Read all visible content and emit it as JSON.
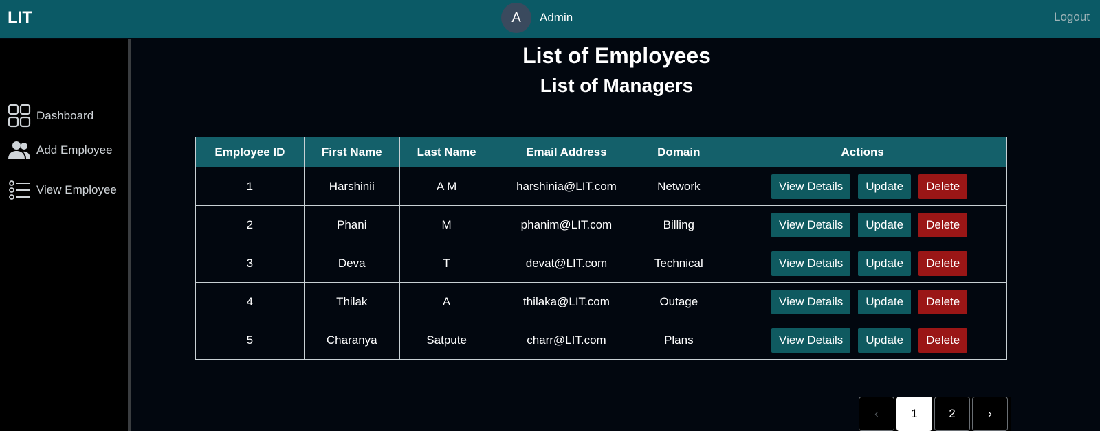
{
  "navbar": {
    "brand": "LIT",
    "avatar_initial": "A",
    "username": "Admin",
    "logout_label": "Logout"
  },
  "sidebar": {
    "items": [
      {
        "label": "Dashboard",
        "icon": "grid-icon"
      },
      {
        "label": "Add Employee",
        "icon": "users-icon"
      },
      {
        "label": "View Employee",
        "icon": "list-icon"
      }
    ]
  },
  "main": {
    "title": "List of Employees",
    "subtitle": "List of Managers"
  },
  "table": {
    "headers": [
      "Employee ID",
      "First Name",
      "Last Name",
      "Email Address",
      "Domain",
      "Actions"
    ],
    "rows": [
      {
        "id": "1",
        "first": "Harshinii",
        "last": "A M",
        "email": "harshinia@LIT.com",
        "domain": "Network"
      },
      {
        "id": "2",
        "first": "Phani",
        "last": "M",
        "email": "phanim@LIT.com",
        "domain": "Billing"
      },
      {
        "id": "3",
        "first": "Deva",
        "last": "T",
        "email": "devat@LIT.com",
        "domain": "Technical"
      },
      {
        "id": "4",
        "first": "Thilak",
        "last": "A",
        "email": "thilaka@LIT.com",
        "domain": "Outage"
      },
      {
        "id": "5",
        "first": "Charanya",
        "last": "Satpute",
        "email": "charr@LIT.com",
        "domain": "Plans"
      }
    ],
    "actions": {
      "view_label": "View Details",
      "update_label": "Update",
      "delete_label": "Delete"
    }
  },
  "pagination": {
    "prev": "‹",
    "pages": [
      "1",
      "2"
    ],
    "current": "1",
    "next": "›"
  },
  "colors": {
    "navbar": "#0b5a66",
    "header": "#14606a",
    "action": "#0f5a60",
    "delete": "#9a1616",
    "background": "#02070f"
  }
}
